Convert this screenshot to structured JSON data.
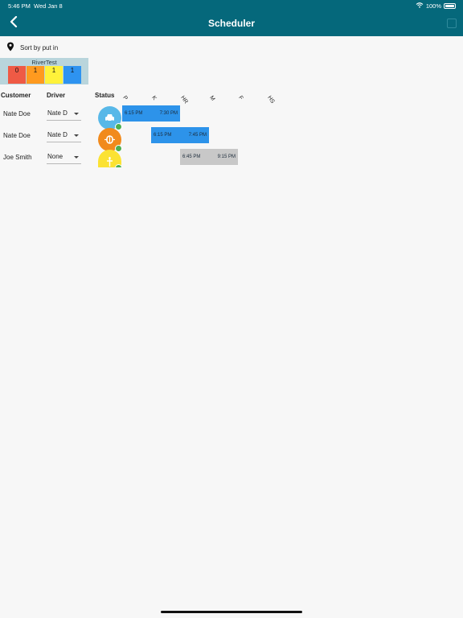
{
  "status_bar": {
    "time": "5:46 PM",
    "date": "Wed Jan 8",
    "battery": "100%"
  },
  "header": {
    "title": "Scheduler"
  },
  "sort": {
    "label": "Sort by put in"
  },
  "legend": {
    "title": "RiverTest",
    "cells": [
      {
        "value": "0",
        "color": "#ef5a45"
      },
      {
        "value": "1",
        "color": "#ff9a1f"
      },
      {
        "value": "1",
        "color": "#fff23a"
      },
      {
        "value": "1",
        "color": "#2e93f0"
      }
    ]
  },
  "columns": {
    "customer": "Customer",
    "driver": "Driver",
    "status": "Status"
  },
  "time_slots": [
    "P",
    "K",
    "HR",
    "M",
    "F",
    "HS"
  ],
  "rows": [
    {
      "customer": "Nate Doe",
      "driver": "Nate D",
      "status_color": "#58b8e8",
      "status_icon": "car-icon",
      "start": "6:15 PM",
      "end": "7:30 PM",
      "bar_color": "#2d93ea",
      "bar_offset_slots": 0
    },
    {
      "customer": "Nate Doe",
      "driver": "Nate D",
      "status_color": "#f18a1c",
      "status_icon": "raft-icon",
      "start": "6:15 PM",
      "end": "7:45 PM",
      "bar_color": "#2d93ea",
      "bar_offset_slots": 1
    },
    {
      "customer": "Joe Smith",
      "driver": "None",
      "status_color": "#fbe233",
      "status_icon": "paddle-icon",
      "start": "6:45 PM",
      "end": "9:15 PM",
      "bar_color": "#c8c8c8",
      "bar_offset_slots": 2
    }
  ]
}
